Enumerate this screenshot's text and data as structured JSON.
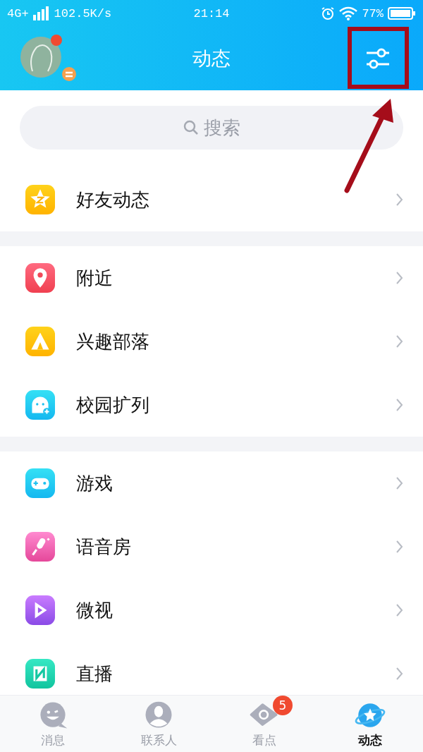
{
  "status_bar": {
    "network": "4G+",
    "speed": "102.5K/s",
    "time": "21:14",
    "battery": "77%"
  },
  "header": {
    "title": "动态"
  },
  "search": {
    "placeholder": "搜索"
  },
  "sections": [
    [
      {
        "kind": "star",
        "label": "好友动态"
      }
    ],
    [
      {
        "kind": "pin",
        "label": "附近"
      },
      {
        "kind": "tent",
        "label": "兴趣部落"
      },
      {
        "kind": "ghost",
        "label": "校园扩列"
      }
    ],
    [
      {
        "kind": "gamepad",
        "label": "游戏"
      },
      {
        "kind": "mic",
        "label": "语音房"
      },
      {
        "kind": "play",
        "label": "微视"
      },
      {
        "kind": "live",
        "label": "直播"
      }
    ]
  ],
  "tab_bar": [
    {
      "kind": "chat",
      "label": "消息",
      "selected": false
    },
    {
      "kind": "contacts",
      "label": "联系人",
      "selected": false
    },
    {
      "kind": "eye",
      "label": "看点",
      "selected": false,
      "badge": "5"
    },
    {
      "kind": "planet",
      "label": "动态",
      "selected": true
    }
  ]
}
